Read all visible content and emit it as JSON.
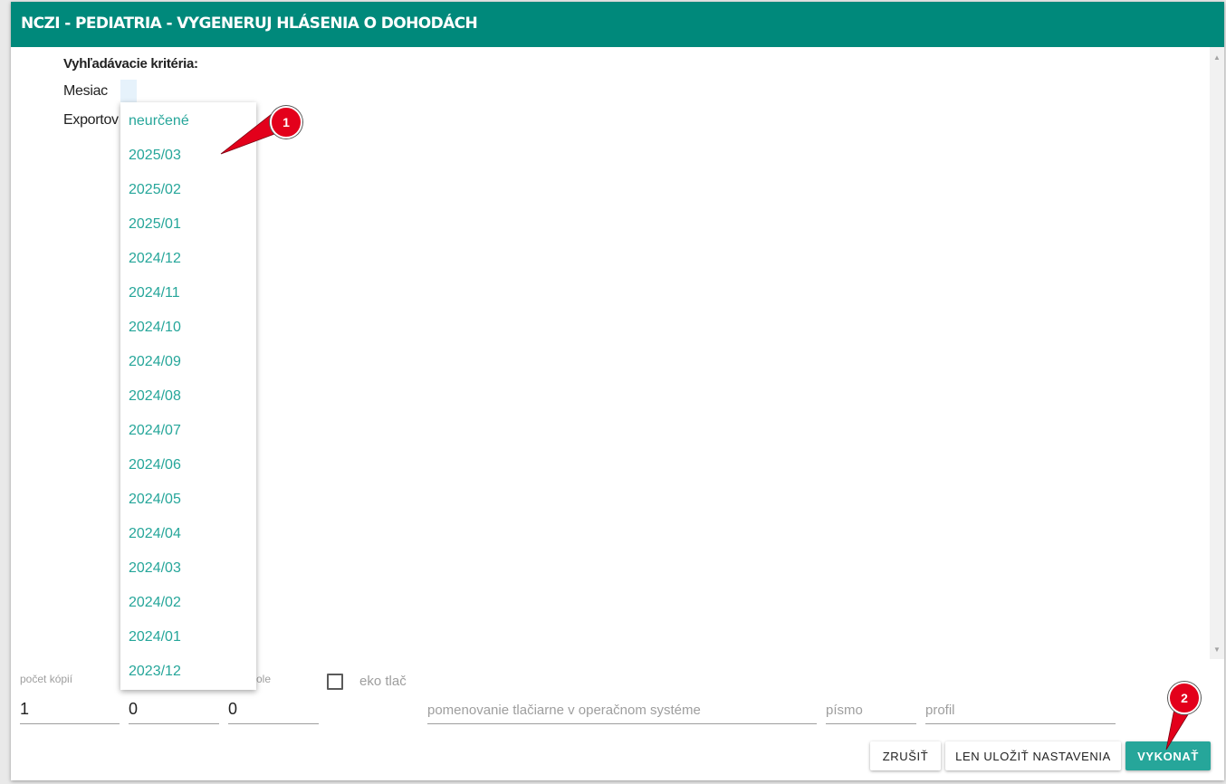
{
  "window": {
    "title": "NCZI - PEDIATRIA - VYGENERUJ HLÁSENIA O DOHODÁCH"
  },
  "criteria": {
    "title": "Vyhľadávacie kritéria:",
    "month_label": "Mesiac",
    "export_label": "Exportov"
  },
  "dropdown": {
    "items": [
      "neurčené",
      "2025/03",
      "2025/02",
      "2025/01",
      "2024/12",
      "2024/11",
      "2024/10",
      "2024/09",
      "2024/08",
      "2024/07",
      "2024/06",
      "2024/05",
      "2024/04",
      "2024/03",
      "2024/02",
      "2024/01",
      "2023/12"
    ]
  },
  "print": {
    "copies_label": "počet kópií",
    "copies_value": "1",
    "field2_value": "0",
    "field3_label": "ole",
    "field3_value": "0",
    "eco_label": "eko tlač",
    "printer_placeholder": "pomenovanie tlačiarne v operačnom systéme",
    "font_placeholder": "písmo",
    "profile_placeholder": "profil"
  },
  "buttons": {
    "cancel": "ZRUŠIŤ",
    "save_settings": "LEN ULOŽIŤ NASTAVENIA",
    "execute": "VYKONAŤ"
  },
  "markers": {
    "first": "1",
    "second": "2"
  },
  "colors": {
    "header": "#00897b",
    "accent": "#26a69a",
    "marker": "#e3001b"
  }
}
